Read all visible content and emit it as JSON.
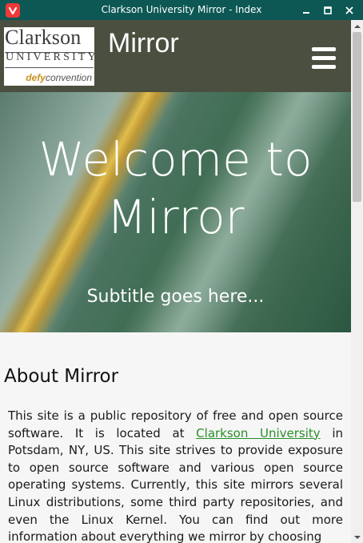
{
  "window": {
    "title": "Clarkson University Mirror - Index"
  },
  "logo": {
    "line1": "Clarkson",
    "line2": "UNIVERSITY",
    "tag_a": "defy",
    "tag_b": "convention"
  },
  "navbar": {
    "brand": "Mirror"
  },
  "hero": {
    "title": "Welcome to Mirror",
    "subtitle": "Subtitle goes here..."
  },
  "about": {
    "title": "About Mirror",
    "text_before": "This site is a public repository of free and open source software. It is located at ",
    "link": "Clarkson University",
    "text_after": " in Potsdam, NY, US. This site strives to provide exposure to open source software and various open source operating systems. Currently, this site mirrors several Linux distributions, some third party repositories, and even the Linux Kernel. You can find out more information about everything we mirror by choosing"
  },
  "colors": {
    "titlebar": "#0d5855",
    "navbar": "#4a4f3f",
    "link": "#2a8e2a",
    "app_icon": "#ef3939"
  },
  "icons": [
    "vivaldi-icon",
    "minimize-icon",
    "maximize-icon",
    "close-icon",
    "hamburger-menu-icon",
    "scroll-up-icon",
    "scroll-down-icon"
  ]
}
